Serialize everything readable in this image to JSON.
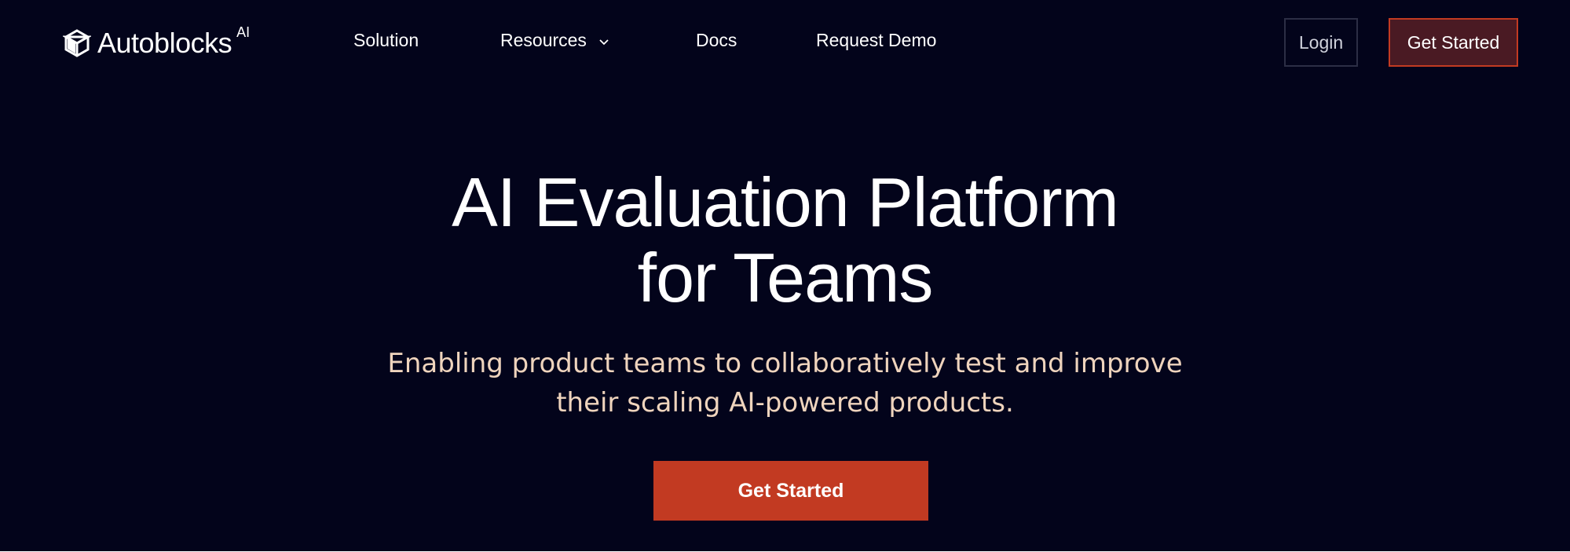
{
  "brand": {
    "name": "Autoblocks",
    "superscript": "AI",
    "logo_icon": "autoblocks-logo-icon"
  },
  "nav": {
    "links": [
      {
        "label": "Solution"
      },
      {
        "label": "Resources",
        "has_dropdown": true,
        "icon": "chevron-down-icon"
      },
      {
        "label": "Docs"
      },
      {
        "label": "Request Demo"
      }
    ],
    "login_label": "Login",
    "get_started_label": "Get Started"
  },
  "hero": {
    "title_line1": "AI Evaluation Platform",
    "title_line2": "for Teams",
    "subtitle_line1": "Enabling product teams to collaboratively test and improve",
    "subtitle_line2": "their scaling AI-powered products.",
    "cta_label": "Get Started"
  },
  "colors": {
    "background": "#03041b",
    "accent": "#c23a22",
    "nav_cta_bg": "#4a1a23",
    "subtitle_text": "#efd4bd",
    "login_border": "#2c2e45"
  }
}
